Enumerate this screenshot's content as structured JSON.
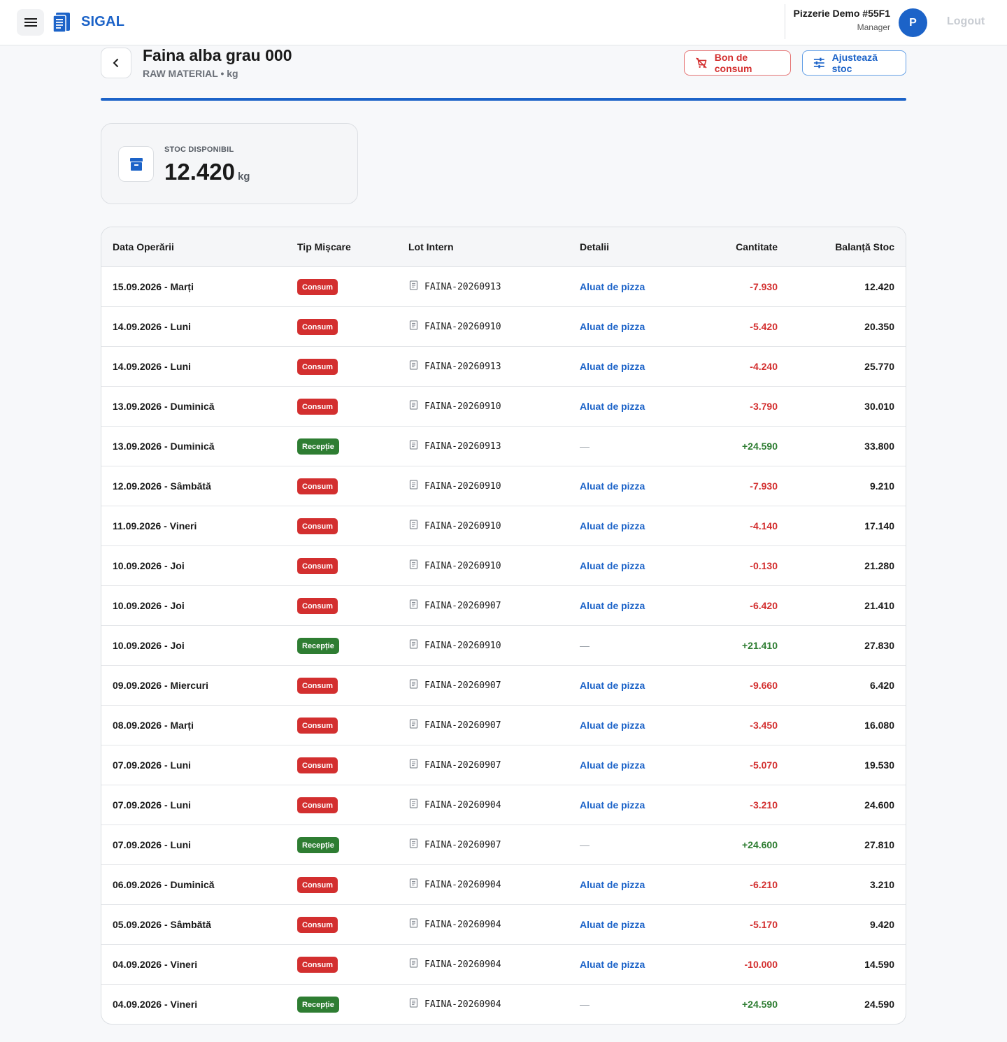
{
  "app": {
    "name": "SIGAL"
  },
  "user": {
    "org": "Pizzerie Demo #55F1",
    "role": "Manager",
    "initial": "P",
    "logout_label": "Logout"
  },
  "product": {
    "title": "Faina alba grau 000",
    "subtitle": "RAW MATERIAL • kg"
  },
  "actions": {
    "bon_label": "Bon de consum",
    "ajust_label": "Ajustează stoc"
  },
  "stock": {
    "label": "STOC DISPONIBIL",
    "value": "12.420",
    "unit": "kg"
  },
  "colors": {
    "accent": "#1c63c8",
    "consum": "#d32f2f",
    "receptie": "#2e7d32"
  },
  "table": {
    "headers": {
      "date": "Data Operării",
      "type": "Tip Mișcare",
      "lot": "Lot Intern",
      "details": "Detalii",
      "qty": "Cantitate",
      "balance": "Balanță Stoc"
    },
    "rows": [
      {
        "date": "15.09.2026 - Marți",
        "type": "Consum",
        "kind": "consum",
        "lot": "FAINA-20260913",
        "details": "Aluat de pizza",
        "qty": "-7.930",
        "balance": "12.420"
      },
      {
        "date": "14.09.2026 - Luni",
        "type": "Consum",
        "kind": "consum",
        "lot": "FAINA-20260910",
        "details": "Aluat de pizza",
        "qty": "-5.420",
        "balance": "20.350"
      },
      {
        "date": "14.09.2026 - Luni",
        "type": "Consum",
        "kind": "consum",
        "lot": "FAINA-20260913",
        "details": "Aluat de pizza",
        "qty": "-4.240",
        "balance": "25.770"
      },
      {
        "date": "13.09.2026 - Duminică",
        "type": "Consum",
        "kind": "consum",
        "lot": "FAINA-20260910",
        "details": "Aluat de pizza",
        "qty": "-3.790",
        "balance": "30.010"
      },
      {
        "date": "13.09.2026 - Duminică",
        "type": "Recepție",
        "kind": "receptie",
        "lot": "FAINA-20260913",
        "details": "—",
        "qty": "+24.590",
        "balance": "33.800"
      },
      {
        "date": "12.09.2026 - Sâmbătă",
        "type": "Consum",
        "kind": "consum",
        "lot": "FAINA-20260910",
        "details": "Aluat de pizza",
        "qty": "-7.930",
        "balance": "9.210"
      },
      {
        "date": "11.09.2026 - Vineri",
        "type": "Consum",
        "kind": "consum",
        "lot": "FAINA-20260910",
        "details": "Aluat de pizza",
        "qty": "-4.140",
        "balance": "17.140"
      },
      {
        "date": "10.09.2026 - Joi",
        "type": "Consum",
        "kind": "consum",
        "lot": "FAINA-20260910",
        "details": "Aluat de pizza",
        "qty": "-0.130",
        "balance": "21.280"
      },
      {
        "date": "10.09.2026 - Joi",
        "type": "Consum",
        "kind": "consum",
        "lot": "FAINA-20260907",
        "details": "Aluat de pizza",
        "qty": "-6.420",
        "balance": "21.410"
      },
      {
        "date": "10.09.2026 - Joi",
        "type": "Recepție",
        "kind": "receptie",
        "lot": "FAINA-20260910",
        "details": "—",
        "qty": "+21.410",
        "balance": "27.830"
      },
      {
        "date": "09.09.2026 - Miercuri",
        "type": "Consum",
        "kind": "consum",
        "lot": "FAINA-20260907",
        "details": "Aluat de pizza",
        "qty": "-9.660",
        "balance": "6.420"
      },
      {
        "date": "08.09.2026 - Marți",
        "type": "Consum",
        "kind": "consum",
        "lot": "FAINA-20260907",
        "details": "Aluat de pizza",
        "qty": "-3.450",
        "balance": "16.080"
      },
      {
        "date": "07.09.2026 - Luni",
        "type": "Consum",
        "kind": "consum",
        "lot": "FAINA-20260907",
        "details": "Aluat de pizza",
        "qty": "-5.070",
        "balance": "19.530"
      },
      {
        "date": "07.09.2026 - Luni",
        "type": "Consum",
        "kind": "consum",
        "lot": "FAINA-20260904",
        "details": "Aluat de pizza",
        "qty": "-3.210",
        "balance": "24.600"
      },
      {
        "date": "07.09.2026 - Luni",
        "type": "Recepție",
        "kind": "receptie",
        "lot": "FAINA-20260907",
        "details": "—",
        "qty": "+24.600",
        "balance": "27.810"
      },
      {
        "date": "06.09.2026 - Duminică",
        "type": "Consum",
        "kind": "consum",
        "lot": "FAINA-20260904",
        "details": "Aluat de pizza",
        "qty": "-6.210",
        "balance": "3.210"
      },
      {
        "date": "05.09.2026 - Sâmbătă",
        "type": "Consum",
        "kind": "consum",
        "lot": "FAINA-20260904",
        "details": "Aluat de pizza",
        "qty": "-5.170",
        "balance": "9.420"
      },
      {
        "date": "04.09.2026 - Vineri",
        "type": "Consum",
        "kind": "consum",
        "lot": "FAINA-20260904",
        "details": "Aluat de pizza",
        "qty": "-10.000",
        "balance": "14.590"
      },
      {
        "date": "04.09.2026 - Vineri",
        "type": "Recepție",
        "kind": "receptie",
        "lot": "FAINA-20260904",
        "details": "—",
        "qty": "+24.590",
        "balance": "24.590"
      }
    ]
  }
}
